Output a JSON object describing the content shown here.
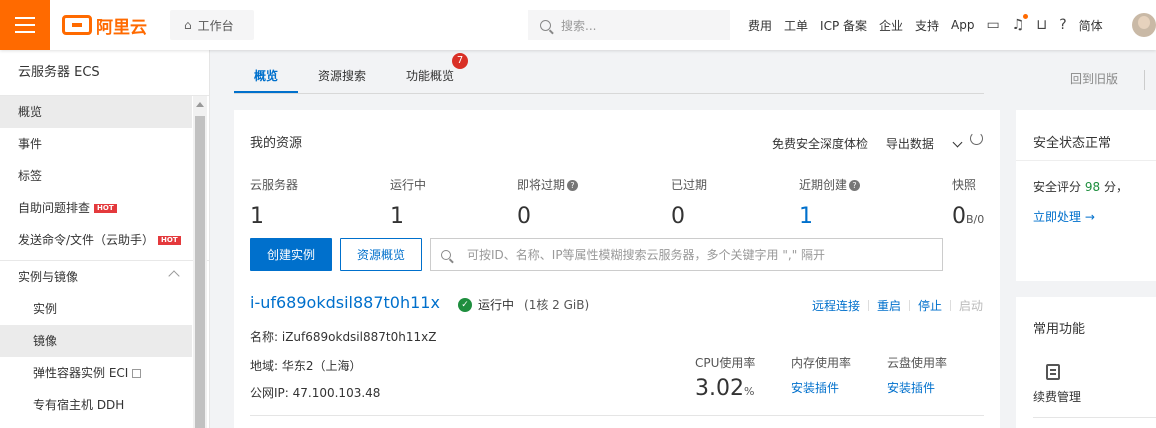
{
  "brand": {
    "name": "阿里云",
    "color": "#ff6a00"
  },
  "topbar": {
    "workbench": "工作台",
    "search_placeholder": "搜索...",
    "nav": [
      "费用",
      "工单",
      "ICP 备案",
      "企业",
      "支持",
      "App"
    ],
    "lang": "简体"
  },
  "sidebar": {
    "title": "云服务器 ECS",
    "items": [
      {
        "label": "概览"
      },
      {
        "label": "事件"
      },
      {
        "label": "标签"
      },
      {
        "label": "自助问题排查",
        "badge": "HOT"
      },
      {
        "label": "发送命令/文件（云助手）",
        "badge": "HOT"
      }
    ],
    "section": {
      "label": "实例与镜像",
      "items": [
        "实例",
        "镜像",
        "弹性容器实例 ECI",
        "专有宿主机 DDH"
      ]
    }
  },
  "tabs": {
    "items": [
      "概览",
      "资源搜索",
      "功能概览"
    ],
    "badge": "7",
    "old_version": "回到旧版"
  },
  "resources": {
    "title": "我的资源",
    "actions": {
      "security_check": "免费安全深度体检",
      "export": "导出数据"
    },
    "stats": [
      {
        "label": "云服务器",
        "value": "1"
      },
      {
        "label": "运行中",
        "value": "1"
      },
      {
        "label": "即将过期",
        "value": "0"
      },
      {
        "label": "已过期",
        "value": "0"
      },
      {
        "label": "近期创建",
        "value": "1"
      },
      {
        "label": "快照",
        "value": "0",
        "unit": "B/0"
      }
    ],
    "create_button": "创建实例",
    "overview_button": "资源概览",
    "search_placeholder": "可按ID、名称、IP等属性模糊搜索云服务器，多个关键字用 \",\" 隔开"
  },
  "instance": {
    "id": "i-uf689okdsil887t0h11x",
    "status": "运行中",
    "spec": "(1核 2 GiB)",
    "ops": [
      "远程连接",
      "重启",
      "停止",
      "启动"
    ],
    "name": "名称: iZuf689okdsil887t0h11xZ",
    "region": "地域: 华东2（上海）",
    "public_ip": "公网IP: 47.100.103.48",
    "metrics": {
      "cpu_label": "CPU使用率",
      "cpu_value": "3.02",
      "cpu_unit": "%",
      "mem_label": "内存使用率",
      "mem_link": "安装插件",
      "disk_label": "云盘使用率",
      "disk_link": "安装插件"
    }
  },
  "security": {
    "title": "安全状态正常",
    "score_prefix": "安全评分",
    "score": "98",
    "score_suffix": "分，",
    "action": "立即处理 →"
  },
  "functions": {
    "title": "常用功能",
    "items": [
      "续费管理"
    ]
  }
}
